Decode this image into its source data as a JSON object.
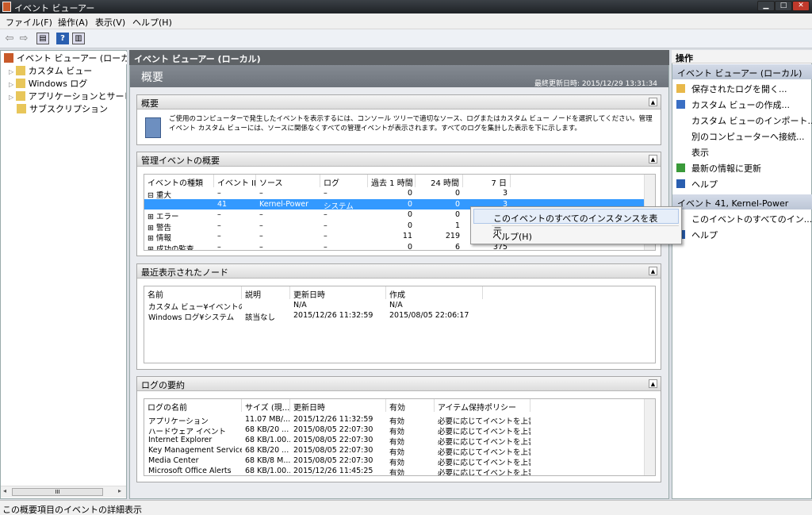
{
  "window": {
    "title": "イベント ビューアー"
  },
  "menu": [
    "ファイル(F)",
    "操作(A)",
    "表示(V)",
    "ヘルプ(H)"
  ],
  "tree": [
    "イベント ビューアー (ローカル)",
    "カスタム ビュー",
    "Windows ログ",
    "アプリケーションとサービス",
    "サブスクリプション"
  ],
  "center": {
    "header": "イベント ビューアー (ローカル)",
    "overview_title": "概要",
    "updated": "最終更新日時: 2015/12/29 13:31:34",
    "summary": {
      "title": "概要",
      "text": "ご使用のコンピューターで発生したイベントを表示するには、コンソール ツリーで適切なソース、ログまたはカスタム ビュー ノードを選択してください。管理イベント カスタム ビューには、ソースに関係なくすべての管理イベントが表示されます。すべてのログを集計した表示を下に示します。"
    },
    "admin": {
      "title": "管理イベントの概要",
      "columns": [
        "イベントの種類",
        "イベント ID",
        "ソース",
        "ログ",
        "過去 1 時間",
        "24 時間",
        "7 日"
      ],
      "rows": [
        [
          "⊟ 重大",
          "–",
          "–",
          "–",
          "0",
          "0",
          "3"
        ],
        [
          "",
          "41",
          "Kernel-Power",
          "システム",
          "0",
          "0",
          "3"
        ],
        [
          "⊞ エラー",
          "–",
          "–",
          "–",
          "0",
          "0",
          ""
        ],
        [
          "⊞ 警告",
          "–",
          "–",
          "–",
          "0",
          "1",
          ""
        ],
        [
          "⊞ 情報",
          "–",
          "–",
          "–",
          "11",
          "219",
          ""
        ],
        [
          "⊞ 成功の監査",
          "–",
          "–",
          "–",
          "0",
          "6",
          "375"
        ]
      ]
    },
    "recent": {
      "title": "最近表示されたノード",
      "columns": [
        "名前",
        "説明",
        "更新日時",
        "作成"
      ],
      "rows": [
        [
          "カスタム ビュー¥イベントの概...",
          "",
          "N/A",
          "N/A"
        ],
        [
          "Windows ログ¥システム",
          "該当なし",
          "2015/12/26 11:32:59",
          "2015/08/05 22:06:17"
        ]
      ]
    },
    "logs": {
      "title": "ログの要約",
      "columns": [
        "ログの名前",
        "サイズ (現...",
        "更新日時",
        "有効",
        "アイテム保持ポリシー"
      ],
      "rows": [
        [
          "アプリケーション",
          "11.07 MB/...",
          "2015/12/26 11:32:59",
          "有効",
          "必要に応じてイベントを上書..."
        ],
        [
          "ハードウェア イベント",
          "68 KB/20 ...",
          "2015/08/05 22:07:30",
          "有効",
          "必要に応じてイベントを上書..."
        ],
        [
          "Internet Explorer",
          "68 KB/1.00...",
          "2015/08/05 22:07:30",
          "有効",
          "必要に応じてイベントを上書..."
        ],
        [
          "Key Management Service",
          "68 KB/20 ...",
          "2015/08/05 22:07:30",
          "有効",
          "必要に応じてイベントを上書..."
        ],
        [
          "Media Center",
          "68 KB/8 M...",
          "2015/08/05 22:07:30",
          "有効",
          "必要に応じてイベントを上書..."
        ],
        [
          "Microsoft Office Alerts",
          "68 KB/1.00...",
          "2015/12/26 11:45:25",
          "有効",
          "必要に応じてイベントを上書..."
        ]
      ]
    }
  },
  "context_menu": [
    "このイベントのすべてのインスタンスを表示",
    "ヘルプ(H)"
  ],
  "actions": {
    "header": "操作",
    "group1": "イベント ビューアー (ローカル)",
    "items1": [
      "保存されたログを開く...",
      "カスタム ビューの作成...",
      "カスタム ビューのインポート...",
      "別のコンピューターへ接続...",
      "表示",
      "最新の情報に更新",
      "ヘルプ"
    ],
    "group2": "イベント 41, Kernel-Power",
    "items2": [
      "このイベントのすべてのイン...",
      "ヘルプ"
    ]
  },
  "status": "この概要項目のイベントの詳細表示",
  "scroll_thumb": "III",
  "colors": {
    "selection": "#3399ff",
    "title_bar": "#2a2e33",
    "group_header": "#c8d0de"
  }
}
